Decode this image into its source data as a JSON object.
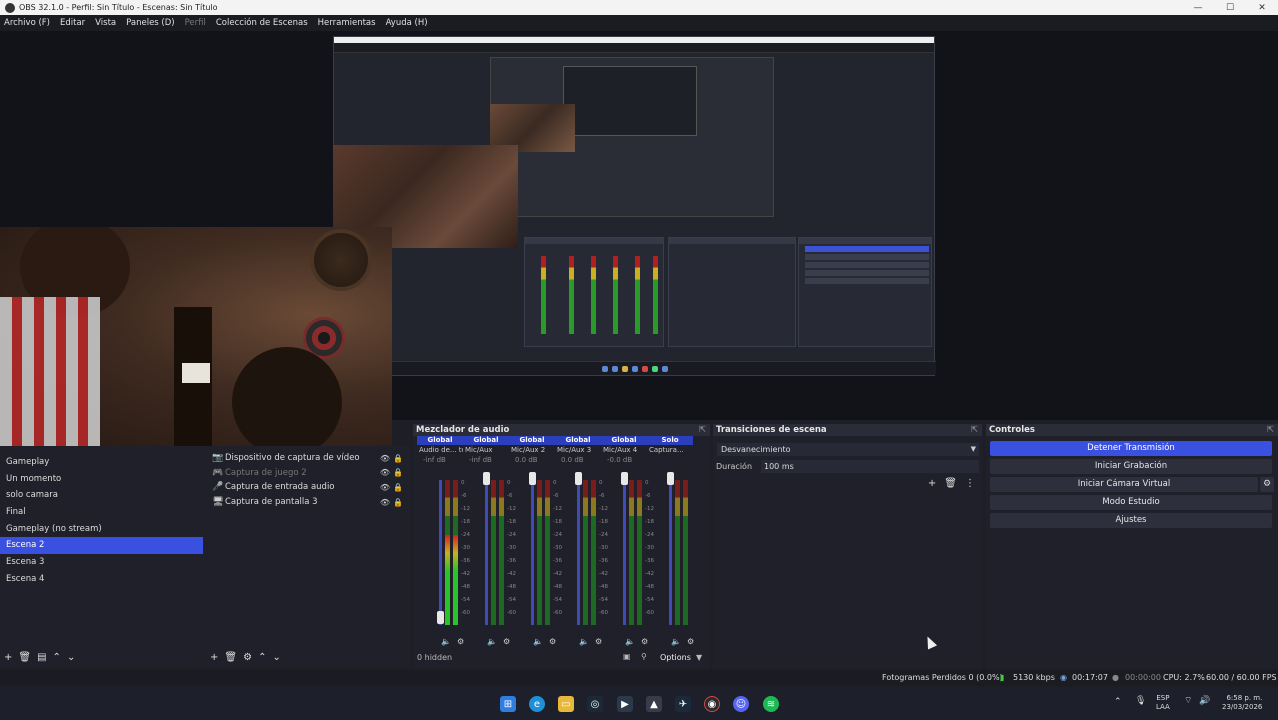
{
  "window": {
    "title": "OBS 32.1.0 - Perfil: Sin Título - Escenas: Sin Título",
    "minimize": "—",
    "maximize": "☐",
    "close": "✕"
  },
  "menu": [
    "Archivo (F)",
    "Editar",
    "Vista",
    "Paneles (D)",
    "Perfil",
    "Colección de Escenas",
    "Herramientas",
    "Ayuda (H)"
  ],
  "scenes": {
    "items": [
      "Gameplay",
      "Un momento",
      "solo camara",
      "Final",
      "Gameplay (no stream)",
      "Escena 2",
      "Escena 3",
      "Escena 4"
    ],
    "selected_index": 5
  },
  "sources": {
    "items": [
      {
        "name": "Dispositivo de captura de vídeo",
        "icon": "camera-icon",
        "glyph": "📷"
      },
      {
        "name": "Captura de juego 2",
        "icon": "gamepad-icon",
        "glyph": "🎮"
      },
      {
        "name": "Captura de entrada audio",
        "icon": "microphone-icon",
        "glyph": "🎤"
      },
      {
        "name": "Captura de pantalla 3",
        "icon": "monitor-icon",
        "glyph": "🖥"
      }
    ]
  },
  "mixer": {
    "title": "Mezclador de audio",
    "channels": [
      {
        "badge": "Global",
        "name": "Audio de... tono 2",
        "db": "-inf dB",
        "level": 0.62
      },
      {
        "badge": "Global",
        "name": "Mic/Aux",
        "db": "-inf dB",
        "level": 0.0
      },
      {
        "badge": "Global",
        "name": "Mic/Aux 2",
        "db": "0.0 dB",
        "level": 0.0
      },
      {
        "badge": "Global",
        "name": "Mic/Aux 3",
        "db": "0.0 dB",
        "level": 0.0
      },
      {
        "badge": "Global",
        "name": "Mic/Aux 4",
        "db": "-0.0 dB",
        "level": 0.0
      },
      {
        "badge": "Solo",
        "name": "Captura...",
        "db": "",
        "level": 0.0
      }
    ],
    "ticks": [
      "0",
      "-6",
      "-12",
      "-18",
      "-24",
      "-30",
      "-36",
      "-42",
      "-48",
      "-54",
      "-60"
    ],
    "hidden_label": "0 hidden",
    "options_label": "Options"
  },
  "transitions": {
    "title": "Transiciones de escena",
    "selected": "Desvanecimiento",
    "duration_label": "Duración",
    "duration_value": "100 ms"
  },
  "controls": {
    "title": "Controles",
    "buttons": [
      "Detener Transmisión",
      "Iniciar Grabación",
      "Iniciar Cámara Virtual",
      "Modo Estudio",
      "Ajustes"
    ]
  },
  "status": {
    "dropped": "Fotogramas Perdidos 0 (0.0%)",
    "bitrate": "5130 kbps",
    "stream_time": "00:17:07",
    "rec_time": "00:00:00",
    "cpu": "CPU: 2.7%",
    "fps": "60.00 / 60.00 FPS"
  },
  "taskbar": {
    "lang": "ESP",
    "lang2": "LAA",
    "time": "6:58 p. m.",
    "date": "23/03/2026"
  },
  "colors": {
    "accent": "#3a50e0",
    "panel": "#1f2029",
    "background": "#1e1f26"
  }
}
